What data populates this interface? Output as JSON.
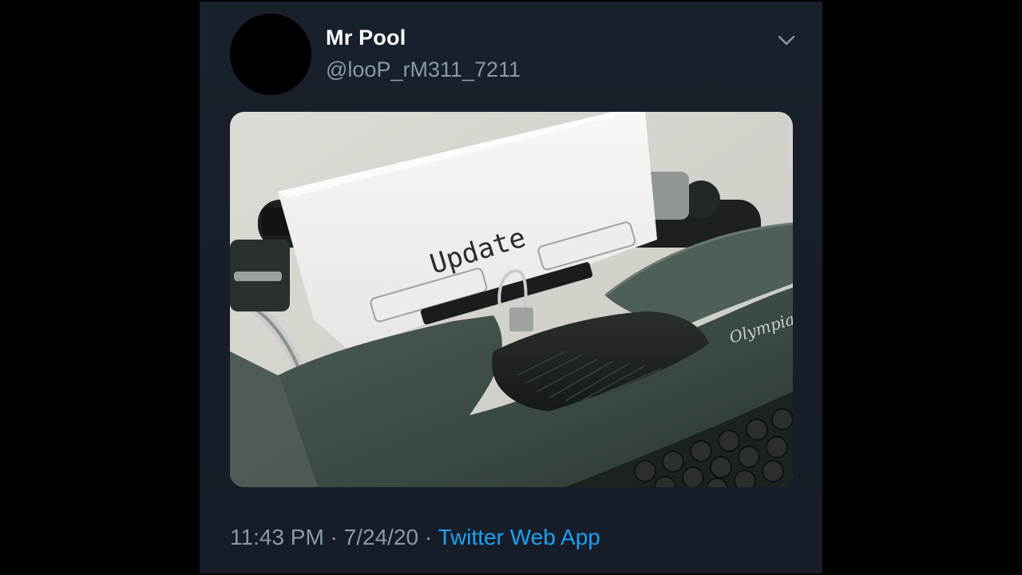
{
  "tweet": {
    "display_name": "Mr Pool",
    "handle": "@looP_rM311_7211",
    "time": "11:43 PM",
    "separator_1": " · ",
    "date": "7/24/20",
    "separator_2": " · ",
    "source": "Twitter Web App",
    "menu_icon": "chevron-down-icon"
  },
  "media": {
    "paper_text": "Update",
    "brand_text": "Olympia"
  },
  "colors": {
    "card_background": "#161d28",
    "name": "#ffffff",
    "secondary_text": "#8899a6",
    "link": "#1da1f2"
  }
}
